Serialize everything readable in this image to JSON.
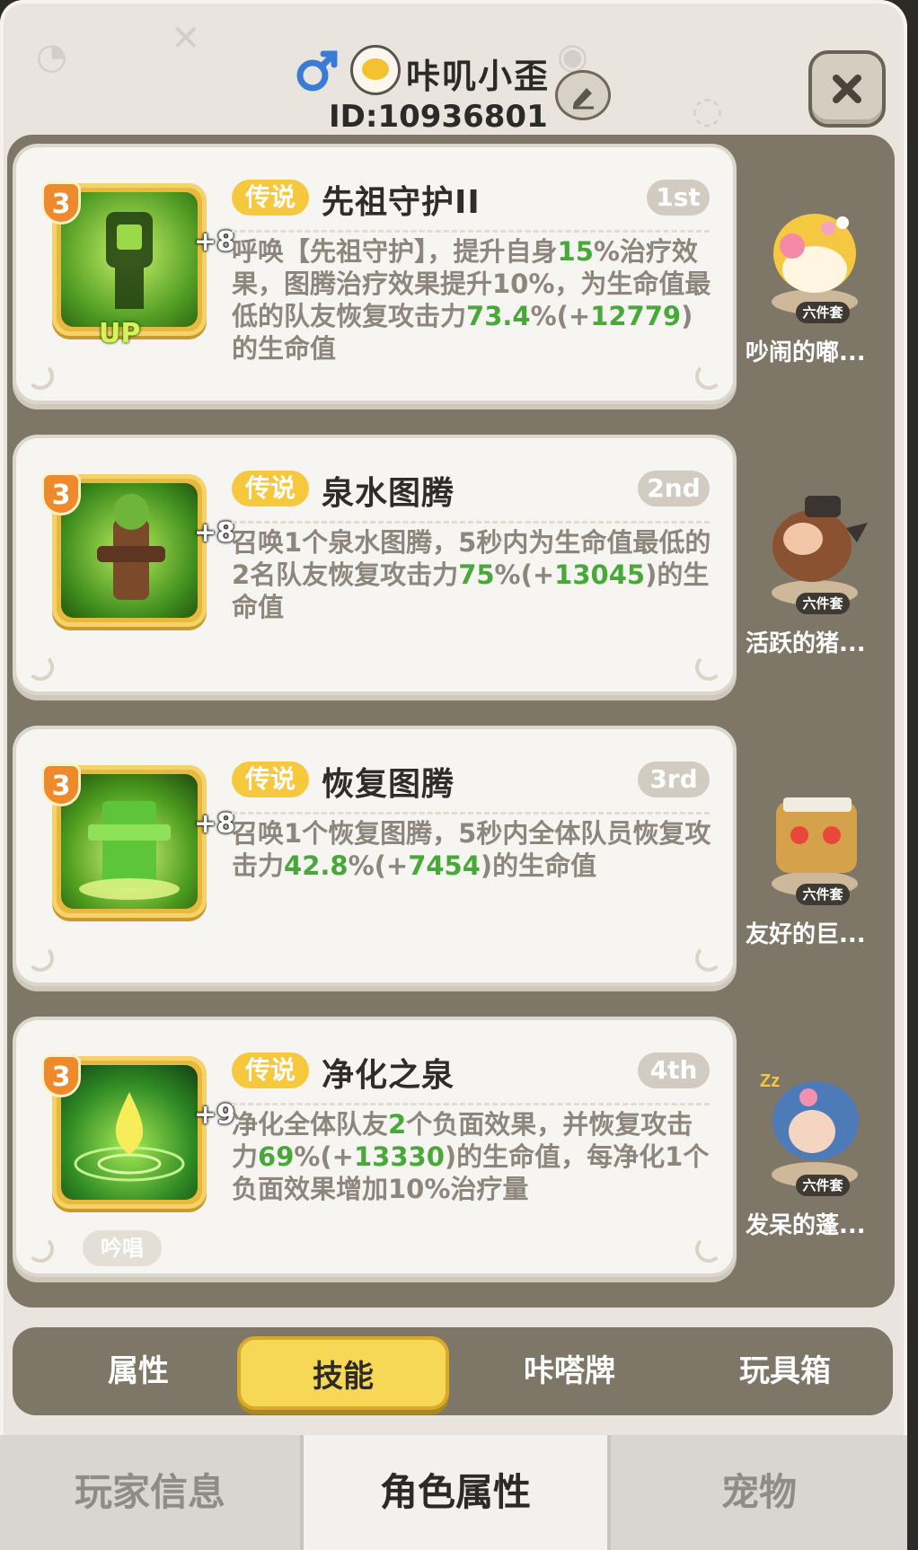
{
  "header": {
    "player_name": "咔叽小歪",
    "player_id": "ID:10936801"
  },
  "skills": [
    {
      "level": "3",
      "plus": "+8",
      "up_badge": "UP",
      "rarity": "传说",
      "name": "先祖守护II",
      "rank": "1st",
      "desc_parts": [
        "呼唤【先祖守护】，提升自身",
        "15",
        "%治疗效果，图腾治疗效果提升10%，为生命值最低的队友恢复攻击力",
        "73.4",
        "%(+",
        "12779",
        ")的生命值"
      ],
      "pet_set": "六件套",
      "pet_name": "吵闹的嘟..."
    },
    {
      "level": "3",
      "plus": "+8",
      "rarity": "传说",
      "name": "泉水图腾",
      "rank": "2nd",
      "desc_parts": [
        "召唤1个泉水图腾，5秒内为生命值最低的2名队友恢复攻击力",
        "75",
        "%(+",
        "13045",
        ")的生命值"
      ],
      "pet_set": "六件套",
      "pet_name": "活跃的猪..."
    },
    {
      "level": "3",
      "plus": "+8",
      "rarity": "传说",
      "name": "恢复图腾",
      "rank": "3rd",
      "desc_parts": [
        "召唤1个恢复图腾，5秒内全体队员恢复攻击力",
        "42.8",
        "%(+",
        "7454",
        ")的生命值"
      ],
      "pet_set": "六件套",
      "pet_name": "友好的巨..."
    },
    {
      "level": "3",
      "plus": "+9",
      "rarity": "传说",
      "name": "净化之泉",
      "rank": "4th",
      "desc_parts": [
        "净化全体队友",
        "2",
        "个负面效果，并恢复攻击力",
        "69",
        "%(+",
        "13330",
        ")的生命值，每净化1个负面效果增加10%治疗量"
      ],
      "chant": "吟唱",
      "pet_set": "六件套",
      "pet_name": "发呆的蓬..."
    }
  ],
  "sub_tabs": [
    "属性",
    "技能",
    "咔嗒牌",
    "玩具箱"
  ],
  "sub_tab_active": "技能",
  "bottom_tabs": [
    "玩家信息",
    "角色属性",
    "宠物"
  ],
  "bottom_tab_active": "角色属性",
  "colors": {
    "highlight_green": "#48a93a",
    "rarity_gold": "#f6c83e",
    "panel_brown": "#7e7768"
  }
}
